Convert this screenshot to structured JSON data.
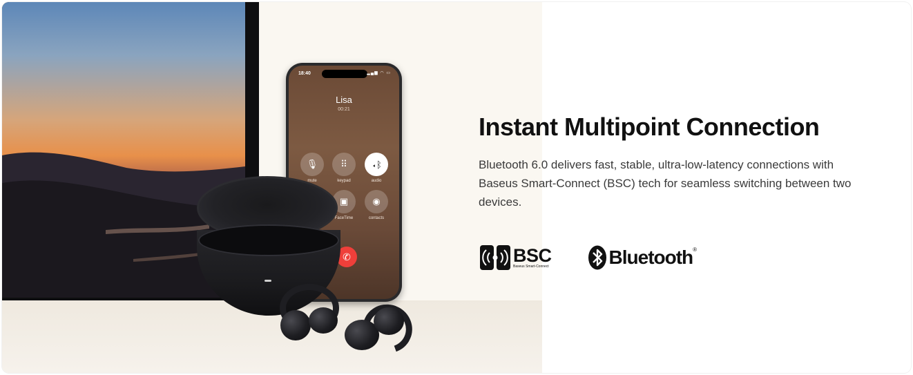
{
  "headline": "Instant Multipoint Connection",
  "description": "Bluetooth 6.0 delivers fast, stable, ultra-low-latency connections with Baseus Smart-Connect (BSC) tech for seamless switching between two devices.",
  "logos": {
    "bsc": {
      "text": "BSC",
      "subtitle": "Baseus Smart-Connect",
      "icon": "bsc-signal-icon"
    },
    "bluetooth": {
      "text": "Bluetooth",
      "registered": "®",
      "icon": "bluetooth-icon"
    }
  },
  "phone": {
    "status_time": "18:40",
    "caller": "Lisa",
    "call_duration": "00:21",
    "controls": [
      {
        "label": "mute",
        "icon": "mic-off-icon",
        "active": false
      },
      {
        "label": "keypad",
        "icon": "keypad-icon",
        "active": false
      },
      {
        "label": "audio",
        "icon": "audio-bluetooth-icon",
        "active": true
      },
      {
        "label": "FaceTime",
        "icon": "facetime-icon",
        "active": false
      },
      {
        "label": "contacts",
        "icon": "contacts-icon",
        "active": false
      }
    ],
    "end_call_icon": "end-call-icon"
  },
  "colors": {
    "headline": "#111111",
    "body_text": "#3a3a3a",
    "scene_background": "#faf7f1",
    "end_call": "#ef3f3a"
  }
}
